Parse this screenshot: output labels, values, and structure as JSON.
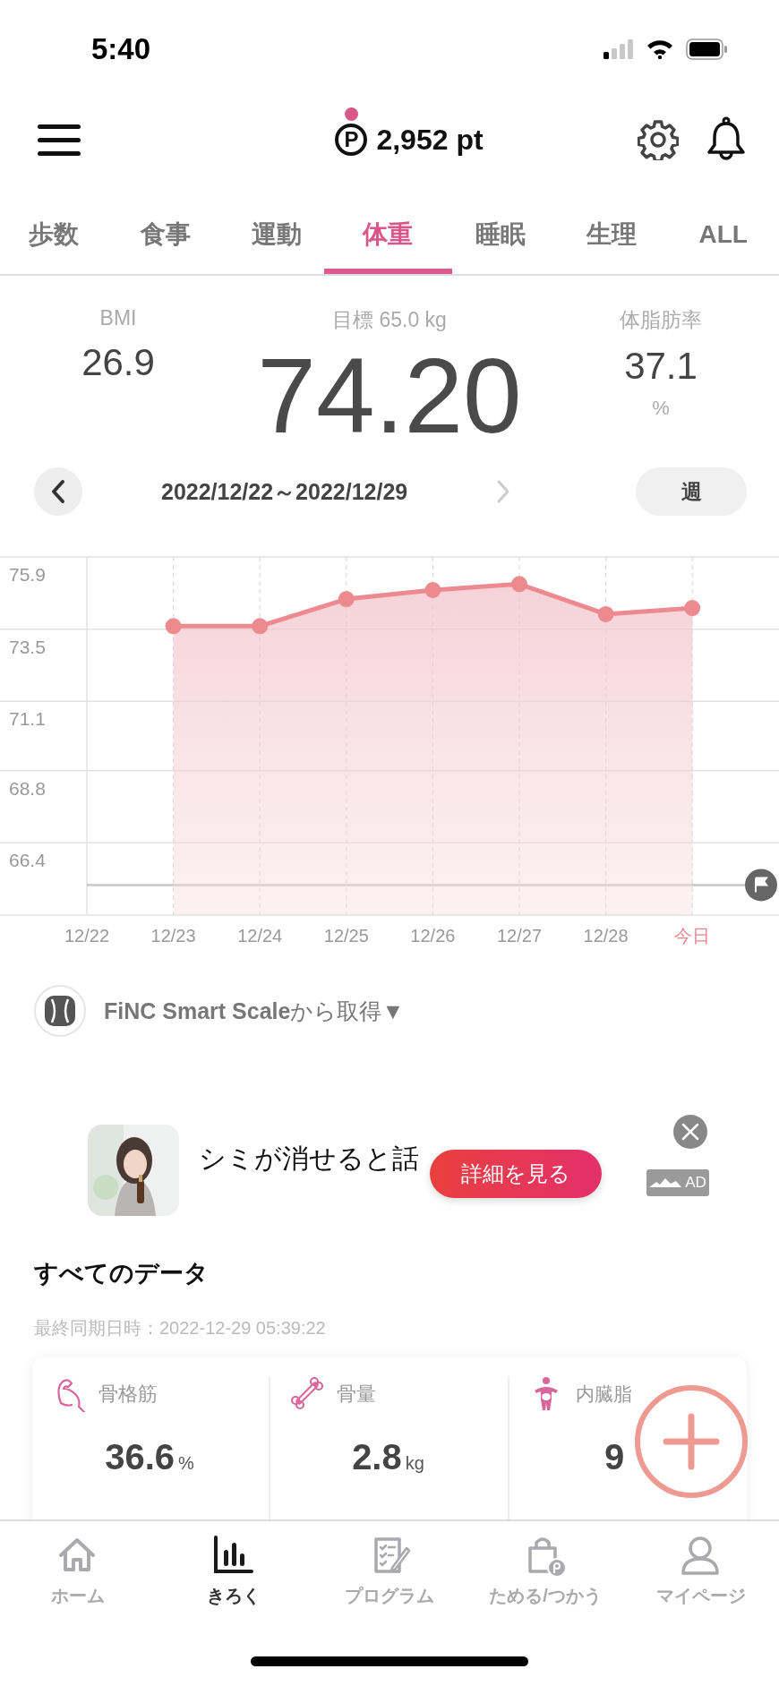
{
  "status_bar": {
    "time": "5:40"
  },
  "header": {
    "points": {
      "symbol": "P",
      "value": "2,952 pt",
      "unread": true
    }
  },
  "tabs": [
    {
      "label": "歩数",
      "selected": false
    },
    {
      "label": "食事",
      "selected": false
    },
    {
      "label": "運動",
      "selected": false
    },
    {
      "label": "体重",
      "selected": true
    },
    {
      "label": "睡眠",
      "selected": false
    },
    {
      "label": "生理",
      "selected": false
    },
    {
      "label": "ALL",
      "selected": false
    }
  ],
  "summary": {
    "bmi": {
      "label": "BMI",
      "value": "26.9"
    },
    "goal": "目標 65.0 kg",
    "weight": "74.20",
    "body_fat": {
      "label": "体脂肪率",
      "value": "37.1",
      "unit": "%"
    }
  },
  "period": {
    "range": "2022/12/22～2022/12/29",
    "next_disabled": true,
    "scale": "週"
  },
  "chart": {
    "chart_data": {
      "type": "area",
      "categories": [
        "12/22",
        "12/23",
        "12/24",
        "12/25",
        "12/26",
        "12/27",
        "12/28",
        "今日"
      ],
      "series": [
        {
          "color": "#ec8a8f",
          "values": [
            null,
            73.6,
            73.6,
            74.5,
            74.8,
            75.0,
            74.0,
            74.2
          ]
        }
      ],
      "ylim": [
        64.0,
        75.9
      ],
      "yticks": [
        66.4,
        68.8,
        71.1,
        73.5,
        75.9
      ],
      "grid": true,
      "ref_lines": [
        {
          "axis": "y",
          "value": 65.0
        }
      ]
    },
    "today_marked": true
  },
  "source": {
    "text": "**FiNC Smart Scale**から取得▼"
  },
  "ad": {
    "title": "シミが消せると話",
    "button": "詳細を見る",
    "badge": "AD"
  },
  "all_data": {
    "title": "すべてのデータ",
    "synced": "最終同期日時：2022-12-29 05:39:22",
    "items": [
      {
        "kind": "muscle",
        "label": "骨格筋",
        "value": "36.6",
        "unit": "%"
      },
      {
        "kind": "bone",
        "label": "骨量",
        "value": "2.8",
        "unit": "kg"
      },
      {
        "kind": "visceral",
        "label": "内臓脂",
        "value": "9"
      }
    ]
  },
  "bottom_nav": [
    {
      "kind": "home",
      "label": "ホーム",
      "selected": false
    },
    {
      "kind": "records",
      "label": "きろく",
      "selected": true
    },
    {
      "kind": "program",
      "label": "プログラム",
      "selected": false
    },
    {
      "kind": "points",
      "label": "ためる/つかう",
      "selected": false
    },
    {
      "kind": "mypage",
      "label": "マイページ",
      "selected": false
    }
  ]
}
